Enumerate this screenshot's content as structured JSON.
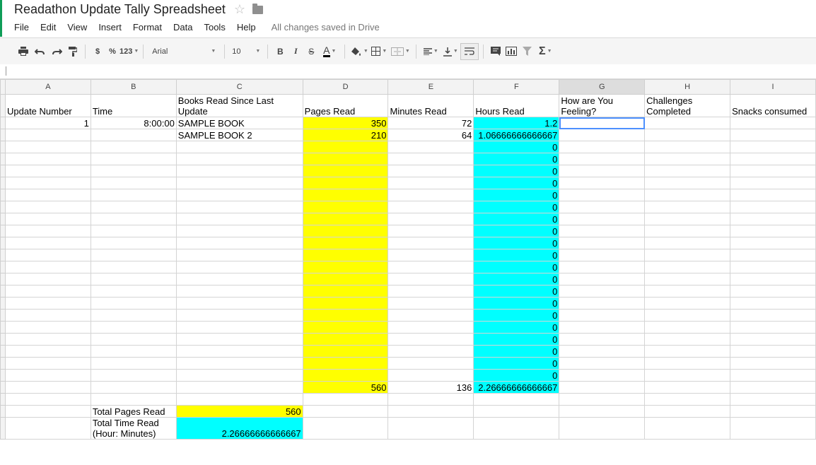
{
  "doc": {
    "title": "Readathon Update Tally Spreadsheet"
  },
  "menu": [
    "File",
    "Edit",
    "View",
    "Insert",
    "Format",
    "Data",
    "Tools",
    "Help"
  ],
  "save_status": "All changes saved in Drive",
  "toolbar": {
    "currency": "$",
    "percent": "%",
    "number_format": "123",
    "font": "Arial",
    "font_size": "10",
    "bold": "B",
    "italic": "I",
    "strike": "S",
    "text_color": "A",
    "sum": "Σ"
  },
  "columns": [
    "A",
    "B",
    "C",
    "D",
    "E",
    "F",
    "G",
    "H",
    "I"
  ],
  "headers": {
    "a": "Update Number",
    "b": "Time",
    "c": "Books Read Since Last Update",
    "d": "Pages Read",
    "e": "Minutes Read",
    "f": "Hours Read",
    "g": "How are You Feeling?",
    "h": "Challenges Completed",
    "i": "Snacks consumed"
  },
  "rows": [
    {
      "a": "1",
      "b": "8:00:00",
      "c": "SAMPLE BOOK",
      "d": "350",
      "e": "72",
      "f": "1.2"
    },
    {
      "a": "",
      "b": "",
      "c": "SAMPLE BOOK 2",
      "d": "210",
      "e": "64",
      "f": "1.06666666666667"
    },
    {
      "f": "0"
    },
    {
      "f": "0"
    },
    {
      "f": "0"
    },
    {
      "f": "0"
    },
    {
      "f": "0"
    },
    {
      "f": "0"
    },
    {
      "f": "0"
    },
    {
      "f": "0"
    },
    {
      "f": "0"
    },
    {
      "f": "0"
    },
    {
      "f": "0"
    },
    {
      "f": "0"
    },
    {
      "f": "0"
    },
    {
      "f": "0"
    },
    {
      "f": "0"
    },
    {
      "f": "0"
    },
    {
      "f": "0"
    },
    {
      "f": "0"
    },
    {
      "f": "0"
    },
    {
      "f": "0"
    }
  ],
  "totals_row": {
    "d": "560",
    "e": "136",
    "f": "2.26666666666667"
  },
  "summary": {
    "pages_label": "Total Pages Read",
    "pages_value": "560",
    "time_label": "Total Time Read (Hour: Minutes)",
    "time_value": "2.26666666666667"
  },
  "colors": {
    "pages_fill": "#ffff00",
    "hours_fill": "#00ffff",
    "selection": "#4d90fe",
    "brand_green": "#0f9d58"
  }
}
